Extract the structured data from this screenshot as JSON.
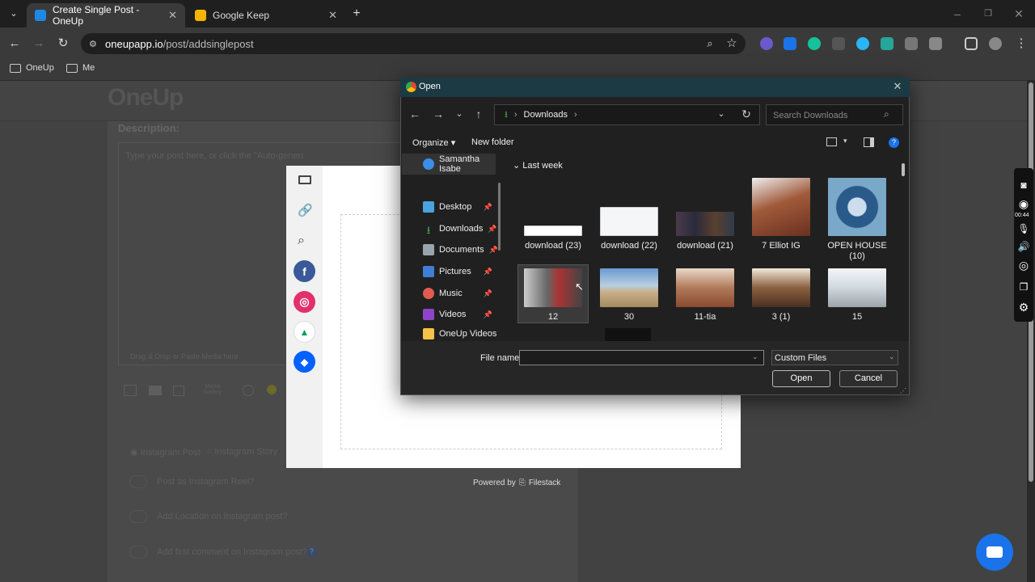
{
  "browser": {
    "tabs": [
      {
        "title": "Create Single Post - OneUp",
        "active": true
      },
      {
        "title": "Google Keep",
        "active": false
      }
    ],
    "url_host": "oneupapp.io",
    "url_path": "/post/addsinglepost",
    "bookmarks": [
      "OneUp",
      "Me"
    ]
  },
  "page": {
    "logo": "OneUp",
    "description_label": "Description:",
    "description_placeholder": "Type your post here, or click the \"Auto-generate caption\" button if you'd",
    "drag_hint": "Drag & Drop or Paste Media here",
    "media_gallery": "Media Gallery",
    "ig_post": "Instagram Post",
    "ig_story": "Instagram Story",
    "post_as_reel": "Post as Instagram Reel?",
    "add_location": "Add Location on Instagram post?",
    "first_comment": "Add first comment on Instagram post?"
  },
  "filestack": {
    "powered_by": "Powered by",
    "brand": "Filestack"
  },
  "dialog": {
    "title": "Open",
    "path": "Downloads",
    "search_placeholder": "Search Downloads",
    "organize": "Organize",
    "new_folder": "New folder",
    "group_label": "Last week",
    "nav_items": [
      {
        "label": "Samantha Isabe",
        "icon": "onedrive-icon",
        "pinned": false
      },
      {
        "label": "Desktop",
        "icon": "desktop-icon",
        "pinned": true
      },
      {
        "label": "Downloads",
        "icon": "download-icon",
        "pinned": true
      },
      {
        "label": "Documents",
        "icon": "document-icon",
        "pinned": true
      },
      {
        "label": "Pictures",
        "icon": "pictures-icon",
        "pinned": true
      },
      {
        "label": "Music",
        "icon": "music-icon",
        "pinned": true
      },
      {
        "label": "Videos",
        "icon": "videos-icon",
        "pinned": true
      },
      {
        "label": "OneUp Videos",
        "icon": "folder-icon",
        "pinned": false
      }
    ],
    "files_row1": [
      {
        "name": "download (23)",
        "color": "#ffffff"
      },
      {
        "name": "download (22)",
        "color": "#f4f6f8"
      },
      {
        "name": "download (21)",
        "color": "#3a3a3a"
      },
      {
        "name": "7 Elliot IG",
        "color": "#8a5a3c"
      },
      {
        "name": "OPEN HOUSE (10)",
        "color": "#2a5a8a"
      }
    ],
    "files_row2": [
      {
        "name": "12",
        "color": "#6d6d70"
      },
      {
        "name": "30",
        "color": "#7aa0c8"
      },
      {
        "name": "11-tia",
        "color": "#b07a5a"
      },
      {
        "name": "3 (1)",
        "color": "#8a6040"
      },
      {
        "name": "15",
        "color": "#d8dde0"
      }
    ],
    "file_name_label": "File name:",
    "file_name_value": "",
    "file_type": "Custom Files",
    "open_button": "Open",
    "cancel_button": "Cancel"
  },
  "recorder": {
    "timer": "00:44"
  }
}
